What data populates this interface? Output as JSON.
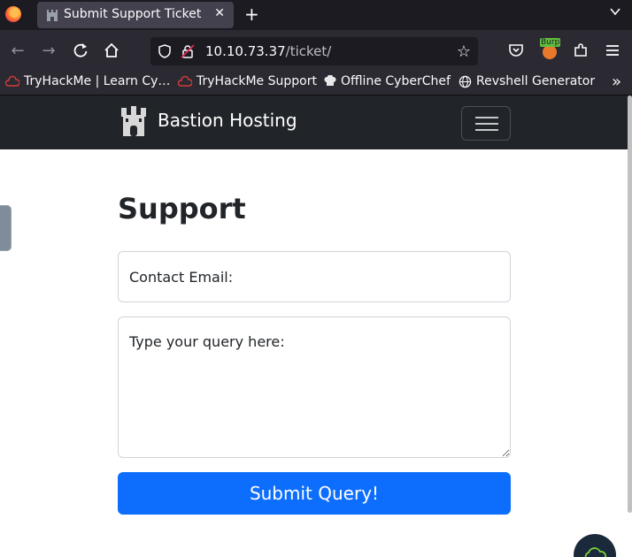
{
  "browser": {
    "tab": {
      "title": "Submit Support Ticket",
      "close": "✕"
    },
    "new_tab": "+",
    "url": {
      "host": "10.10.73.37",
      "path": "/ticket/"
    },
    "bookmarks": [
      {
        "label": "TryHackMe | Learn Cy…",
        "icon": "tryhackme-icon"
      },
      {
        "label": "TryHackMe Support",
        "icon": "tryhackme-icon"
      },
      {
        "label": "Offline CyberChef",
        "icon": "chef-icon"
      },
      {
        "label": "Revshell Generator",
        "icon": "globe-icon"
      }
    ],
    "extension_badge": "Burp"
  },
  "site": {
    "brand": "Bastion Hosting",
    "heading": "Support",
    "form": {
      "email_placeholder": "Contact Email:",
      "query_placeholder": "Type your query here:",
      "submit_label": "Submit Query!"
    }
  },
  "colors": {
    "navbar": "#212529",
    "primary": "#0d6efd",
    "browser_dark": "#1c1b22"
  }
}
